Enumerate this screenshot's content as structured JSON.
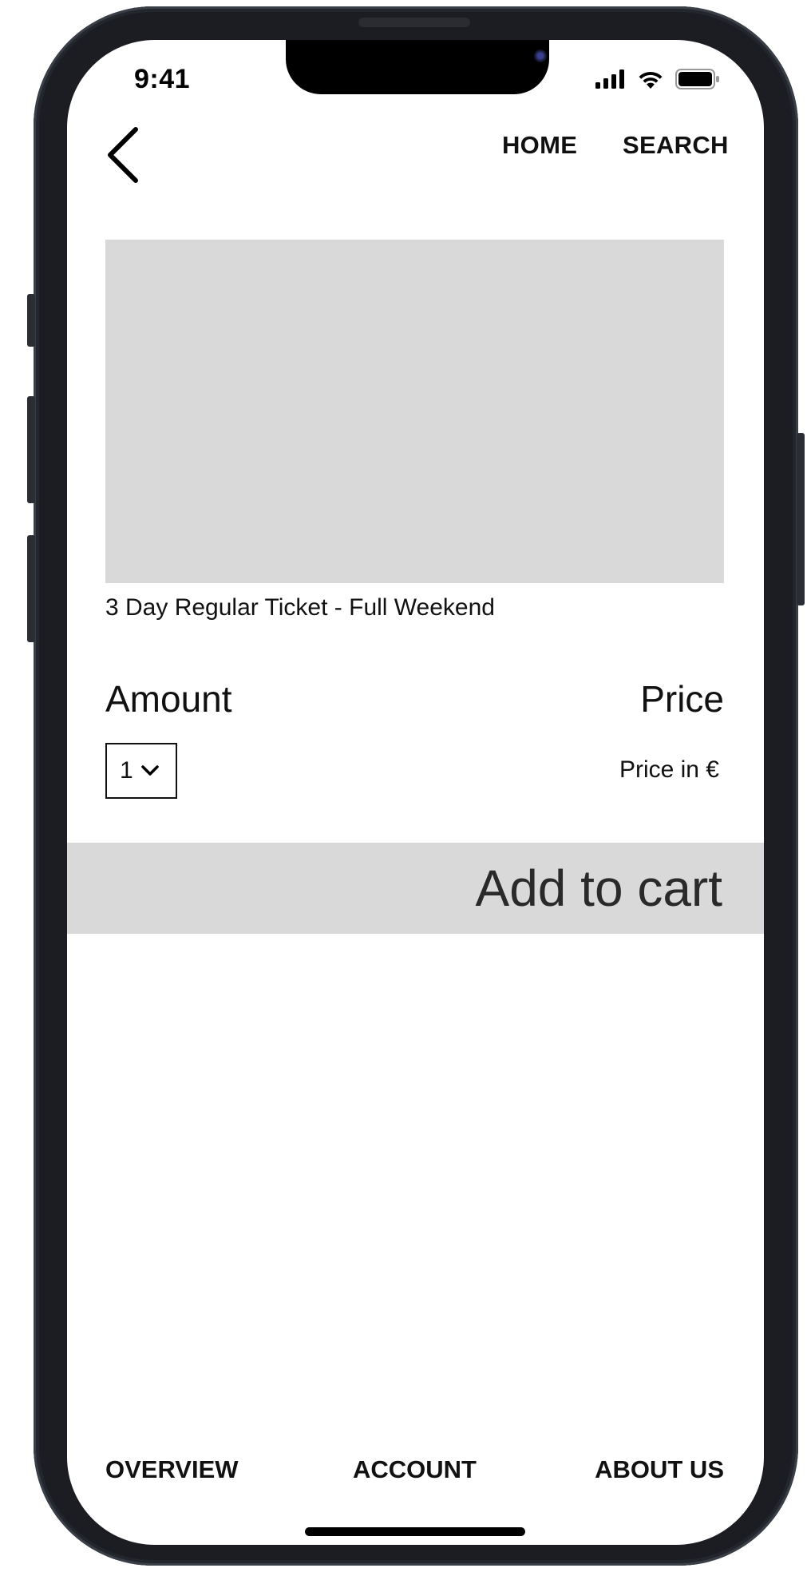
{
  "status_bar": {
    "time": "9:41"
  },
  "top_nav": {
    "home_label": "HOME",
    "search_label": "SEARCH"
  },
  "product": {
    "title": "3 Day Regular Ticket - Full Weekend",
    "amount_label": "Amount",
    "price_label": "Price",
    "quantity_selected": "1",
    "price_value": "Price in €"
  },
  "cta": {
    "add_to_cart_label": "Add to cart"
  },
  "bottom_nav": {
    "items": [
      {
        "label": "OVERVIEW"
      },
      {
        "label": "ACCOUNT"
      },
      {
        "label": "ABOUT US"
      }
    ]
  },
  "colors": {
    "placeholder_gray": "#d9d9d9",
    "text": "#111111",
    "frame": "#1b1d22"
  }
}
